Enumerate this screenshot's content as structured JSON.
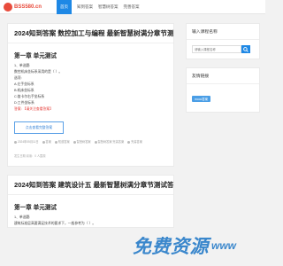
{
  "header": {
    "logo_text": "BSS580.cn",
    "nav": [
      "首页",
      "知到答案",
      "智慧树答案",
      "完善答案"
    ]
  },
  "articles": [
    {
      "title": "2024知到答案 数控加工与编程 最新智慧树满分章节测试答案",
      "chapter": "第一章 单元测试",
      "lines": [
        "1、单选题:",
        "数控机床坐标系采用的是（  ）。",
        "选项:",
        "A:左手坐标系",
        "B:机床坐标系",
        "C:笛卡尔右手坐标系",
        "D:工件坐标系"
      ],
      "answer_line": "答案: 【请关注查看答案】",
      "button_label": "点击查看完整答案",
      "meta": [
        "2024年05月11日",
        "答案",
        "知道答案",
        "智慧树答案",
        "智慧树答案 完善答案",
        "完善答案",
        "完善答案"
      ],
      "footer": "发生日期 阅读：0 人围观"
    },
    {
      "title": "2024知到答案 建筑设计五 最新智慧树满分章节测试答案",
      "chapter": "第一章 单元测试",
      "lines": [
        "1、单选题:",
        "建筑标准层高要满足技术的要求下，一般参考为（  ）。"
      ]
    }
  ],
  "sidebar": {
    "search_title": "输入课程名称",
    "search_placeholder": "请输入课程名称",
    "links_title": "友情链接",
    "links": [
      "mooc答案"
    ]
  },
  "watermark": {
    "text": "免费资源",
    "suffix": "www"
  },
  "colors": {
    "accent": "#1e88e5",
    "brand": "#e84b3c",
    "answer_red": "#e53935"
  }
}
